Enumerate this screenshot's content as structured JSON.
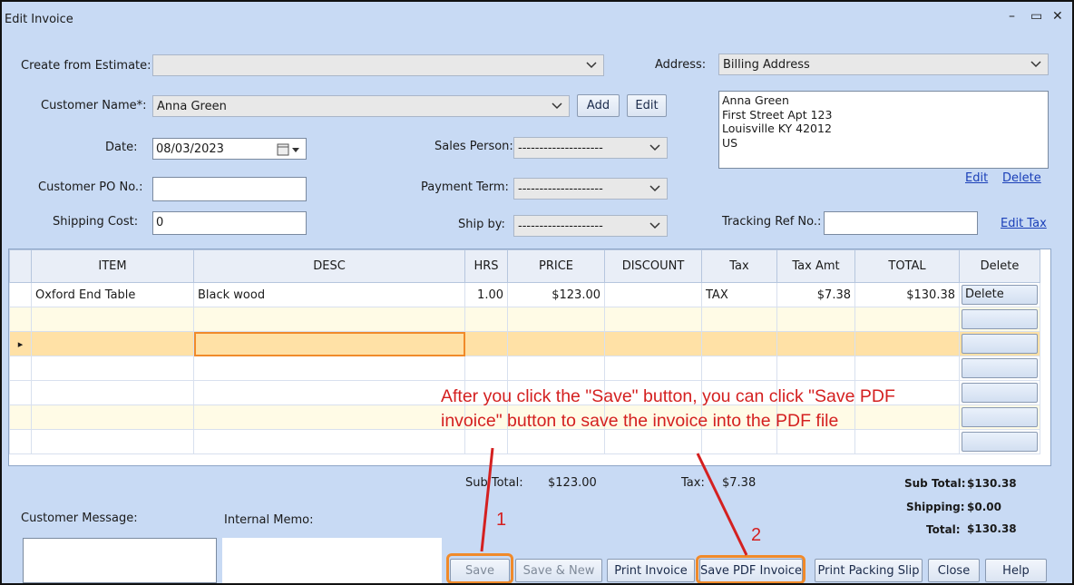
{
  "window": {
    "title": "Edit Invoice",
    "minimize": "–",
    "maximize": "▭",
    "close": "✕"
  },
  "form": {
    "create_from_estimate_label": "Create from Estimate:",
    "create_from_estimate_value": "",
    "address_label": "Address:",
    "address_type": "Billing Address",
    "customer_name_label": "Customer Name*:",
    "customer_name": "Anna Green",
    "add_label": "Add",
    "edit_label": "Edit",
    "date_label": "Date:",
    "date": "08/03/2023",
    "sales_person_label": "Sales Person:",
    "sales_person": "--------------------",
    "customer_po_label": "Customer PO No.:",
    "customer_po": "",
    "payment_term_label": "Payment Term:",
    "payment_term": "--------------------",
    "shipping_cost_label": "Shipping Cost:",
    "shipping_cost": "0",
    "ship_by_label": "Ship by:",
    "ship_by": "--------------------",
    "tracking_label": "Tracking Ref No.:",
    "tracking": "",
    "address_lines": [
      "Anna Green",
      "First Street Apt 123",
      "Louisville  KY  42012",
      "US"
    ],
    "address_edit": "Edit",
    "address_delete": "Delete",
    "edit_tax": "Edit Tax"
  },
  "grid": {
    "columns": [
      "ITEM",
      "DESC",
      "HRS",
      "PRICE",
      "DISCOUNT",
      "Tax",
      "Tax Amt",
      "TOTAL",
      "Delete"
    ],
    "rows": [
      {
        "item": "Oxford End Table",
        "desc": "Black wood",
        "hrs": "1.00",
        "price": "$123.00",
        "discount": "",
        "tax": "TAX",
        "tax_amt": "$7.38",
        "total": "$130.38",
        "delete": "Delete"
      }
    ],
    "selected_row_marker": "▸"
  },
  "summary": {
    "sub_total_label": "Sub Total:",
    "sub_total": "$123.00",
    "tax_label": "Tax:",
    "tax": "$7.38",
    "right_sub_total_label": "Sub Total:",
    "right_sub_total": "$130.38",
    "shipping_label": "Shipping:",
    "shipping": "$0.00",
    "total_label": "Total:",
    "total": "$130.38"
  },
  "memo": {
    "customer_message_label": "Customer Message:",
    "internal_memo_label": "Internal Memo:"
  },
  "buttons": {
    "save": "Save",
    "save_new": "Save & New",
    "print_invoice": "Print Invoice",
    "save_pdf": "Save PDF Invoice",
    "print_packing": "Print Packing Slip",
    "close": "Close",
    "help": "Help"
  },
  "annotation": {
    "text": "After you click the \"Save\" button, you can click \"Save PDF invoice\" button to save the invoice into the PDF file",
    "marker1": "1",
    "marker2": "2",
    "color": "#d42020",
    "highlight_color": "#f08a2a"
  }
}
